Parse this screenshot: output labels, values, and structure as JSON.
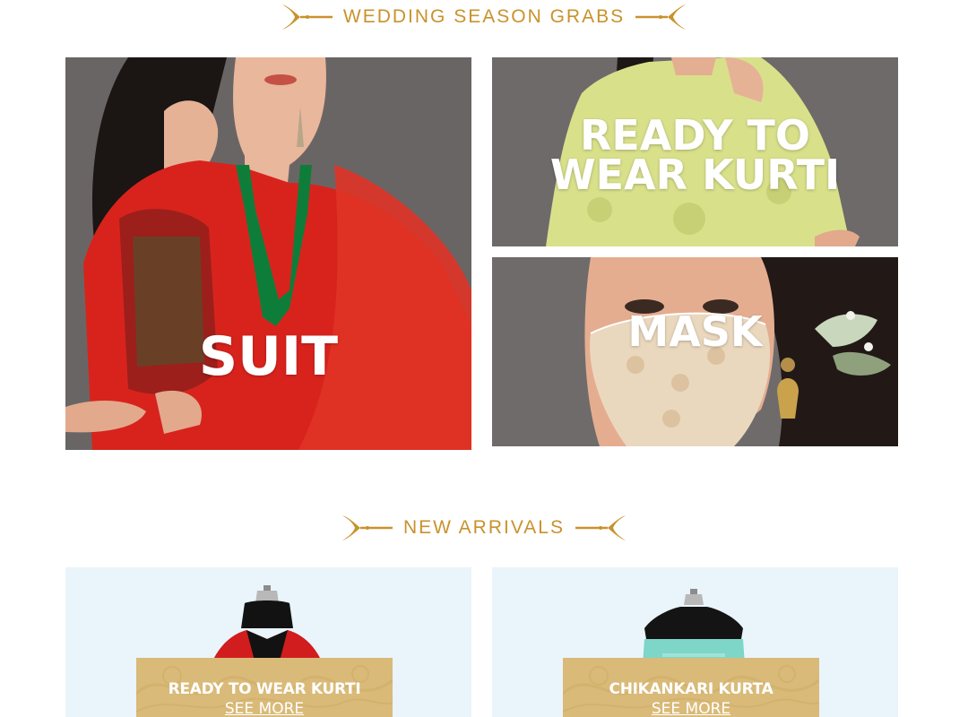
{
  "sections": {
    "wedding": {
      "title": "WEDDING SEASON GRABS"
    },
    "arrivals": {
      "title": "NEW ARRIVALS"
    }
  },
  "tiles": {
    "suit": {
      "label": "SUIT"
    },
    "kurti": {
      "line1": "READY TO",
      "line2": "WEAR KURTI"
    },
    "mask": {
      "label": "MASK"
    }
  },
  "arrivals": [
    {
      "name": "READY TO WEAR KURTI",
      "cta": "SEE MORE"
    },
    {
      "name": "CHIKANKARI KURTA",
      "cta": "SEE MORE"
    }
  ],
  "colors": {
    "accent": "#c9922c",
    "tile_bg": "#6b6767",
    "arrival_bg": "#eaf4fb",
    "label_bg": "#d9ba78"
  }
}
